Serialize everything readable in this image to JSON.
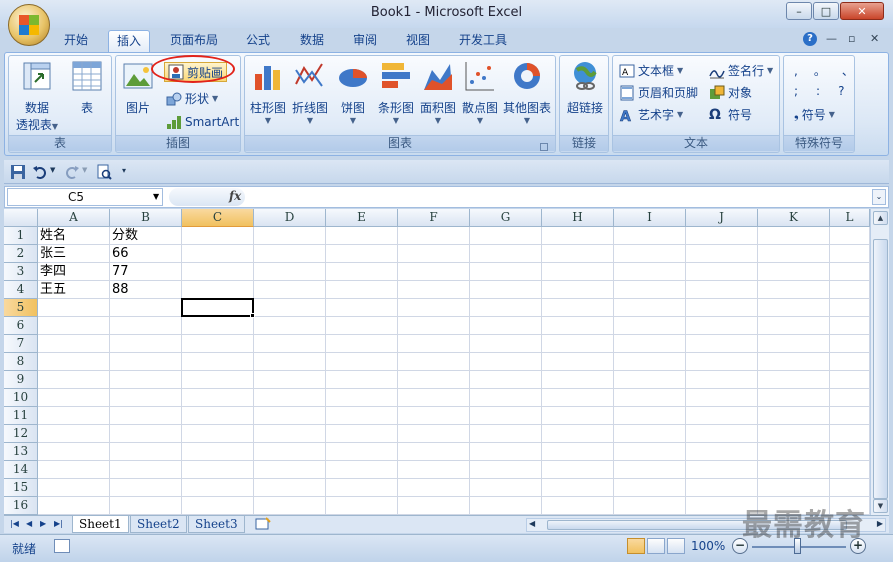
{
  "window": {
    "title": "Book1 - Microsoft Excel",
    "minimize_glyph": "–",
    "maximize_glyph": "□",
    "close_glyph": "✕"
  },
  "tabs": [
    "开始",
    "插入",
    "页面布局",
    "公式",
    "数据",
    "审阅",
    "视图",
    "开发工具"
  ],
  "active_tab": "插入",
  "help_glyph": "?",
  "ribbon_controls": [
    "—",
    "▫",
    "✕"
  ],
  "ribbon": {
    "table_group": {
      "label": "表",
      "pivot_label_1": "数据",
      "pivot_label_2": "透视表",
      "table_label": "表"
    },
    "illustrations_group": {
      "label": "插图",
      "picture_label": "图片",
      "clipart_label": "剪贴画",
      "shapes_label": "形状",
      "smartart_label": "SmartArt"
    },
    "charts_group": {
      "label": "图表",
      "items": [
        "柱形图",
        "折线图",
        "饼图",
        "条形图",
        "面积图",
        "散点图",
        "其他图表"
      ]
    },
    "links_group": {
      "label": "链接",
      "hyperlink_label": "超链接"
    },
    "text_group": {
      "label": "文本",
      "textbox": "文本框",
      "header_footer": "页眉和页脚",
      "wordart": "艺术字",
      "signature": "签名行",
      "object": "对象",
      "symbol": "符号"
    },
    "special_group": {
      "label": "特殊符号",
      "row1": [
        ",",
        "。",
        "、"
      ],
      "row2": [
        ";",
        ":",
        "?"
      ],
      "symbol_label": "符号"
    }
  },
  "formula_bar": {
    "name_box": "C5",
    "fx": "fx",
    "formula": ""
  },
  "columns": [
    "A",
    "B",
    "C",
    "D",
    "E",
    "F",
    "G",
    "H",
    "I",
    "J",
    "K",
    "L"
  ],
  "rows": [
    "1",
    "2",
    "3",
    "4",
    "5",
    "6",
    "7",
    "8",
    "9",
    "10",
    "11",
    "12",
    "13",
    "14",
    "15",
    "16"
  ],
  "selected": {
    "col": "C",
    "row": "5"
  },
  "cells": [
    {
      "ref": "A1",
      "value": "姓名"
    },
    {
      "ref": "B1",
      "value": "分数"
    },
    {
      "ref": "A2",
      "value": "张三"
    },
    {
      "ref": "B2",
      "value": "66"
    },
    {
      "ref": "A3",
      "value": "李四"
    },
    {
      "ref": "B3",
      "value": "77"
    },
    {
      "ref": "A4",
      "value": "王五"
    },
    {
      "ref": "B4",
      "value": "88"
    }
  ],
  "sheets": [
    "Sheet1",
    "Sheet2",
    "Sheet3"
  ],
  "active_sheet": "Sheet1",
  "status": {
    "text": "就绪",
    "zoom": "100%"
  },
  "watermark": "最需教育",
  "colors": {
    "accent": "#15428b",
    "highlight_circle": "#e2231a",
    "selected_header": "#f1c15f"
  }
}
